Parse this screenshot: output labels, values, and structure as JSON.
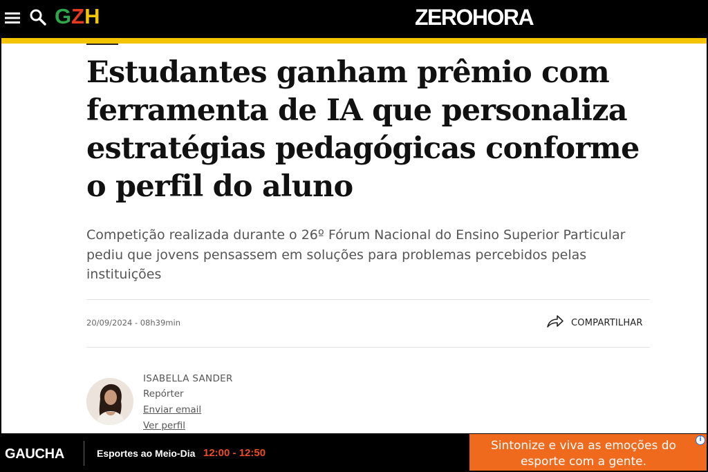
{
  "header": {
    "gzh_logo": {
      "g": "G",
      "z": "Z",
      "h": "H"
    },
    "zh_logo": "ZEROHORA",
    "menu_icon": "menu-icon",
    "search_icon": "search-icon"
  },
  "article": {
    "headline": "Estudantes ganham prêmio com ferramenta de IA que personaliza estratégias pedagógicas conforme o perfil do aluno",
    "subtitle": "Competição realizada durante o 26º Fórum Nacional do Ensino Superior Particular pediu que jovens pensassem em soluções para problemas percebidos pelas instituições",
    "datetime": "20/09/2024 - 08h39min",
    "share_label": "COMPARTILHAR",
    "share_icon": "share-arrow-icon"
  },
  "author": {
    "name": "ISABELLA SANDER",
    "role": "Repórter",
    "email_link": "Enviar email",
    "profile_link": "Ver perfil"
  },
  "bottom_bar": {
    "station": "GAUCHA",
    "program": "Esportes ao Meio-Dia",
    "time": "12:00 - 12:50"
  },
  "ad": {
    "text": "Sintonize e viva as emoções do esporte com a gente.",
    "info_icon": "i"
  },
  "colors": {
    "header_bg": "#000000",
    "accent_yellow": "#f5c400",
    "gzh_green": "#2ea64a",
    "gzh_red": "#e53a1f",
    "time_red": "#f04b24",
    "ad_orange": "#f06a1e"
  }
}
